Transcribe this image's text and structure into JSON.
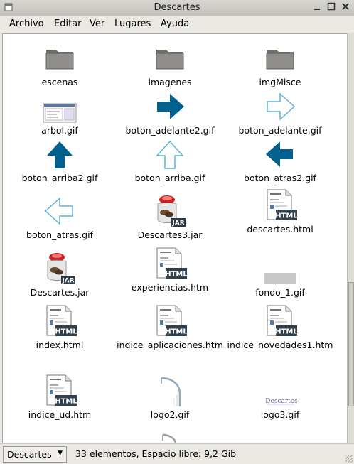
{
  "window": {
    "title": "Descartes"
  },
  "menu": [
    "Archivo",
    "Editar",
    "Ver",
    "Lugares",
    "Ayuda"
  ],
  "items": [
    {
      "label": "escenas",
      "icon": "folder-icon"
    },
    {
      "label": "imagenes",
      "icon": "folder-icon"
    },
    {
      "label": "imgMisce",
      "icon": "folder-icon"
    },
    {
      "label": "arbol.gif",
      "icon": "image-thumbnail-icon"
    },
    {
      "label": "boton_adelante2.gif",
      "icon": "arrow-right-filled-icon"
    },
    {
      "label": "boton_adelante.gif",
      "icon": "arrow-right-outline-icon"
    },
    {
      "label": "boton_arriba2.gif",
      "icon": "arrow-up-filled-icon"
    },
    {
      "label": "boton_arriba.gif",
      "icon": "arrow-up-outline-icon"
    },
    {
      "label": "boton_atras2.gif",
      "icon": "arrow-left-filled-icon"
    },
    {
      "label": "boton_atras.gif",
      "icon": "arrow-left-outline-icon"
    },
    {
      "label": "Descartes3.jar",
      "icon": "jar-icon"
    },
    {
      "label": "descartes.html",
      "icon": "html-document-icon"
    },
    {
      "label": "Descartes.jar",
      "icon": "jar-icon"
    },
    {
      "label": "experiencias.htm",
      "icon": "html-document-icon"
    },
    {
      "label": "fondo_1.gif",
      "icon": "gray-image-icon"
    },
    {
      "label": "index.html",
      "icon": "html-document-icon"
    },
    {
      "label": "indice_aplicaciones.htm",
      "icon": "html-document-icon"
    },
    {
      "label": "indice_novedades1.htm",
      "icon": "html-document-icon"
    },
    {
      "label": "indice_ud.htm",
      "icon": "html-document-icon"
    },
    {
      "label": "logo2.gif",
      "icon": "logo-d-icon"
    },
    {
      "label": "logo3.gif",
      "icon": "logo-descartes-icon"
    }
  ],
  "html_badge": "HTML",
  "jar_badge": "JAR",
  "logo3_text": "Descartes",
  "status": {
    "location": "Descartes",
    "text": "33 elementos, Espacio libre: 9,2 Gib"
  },
  "colors": {
    "arrow_blue": "#00608e",
    "outline_blue": "#5ab4d8",
    "folder": "#8f8e8a"
  }
}
